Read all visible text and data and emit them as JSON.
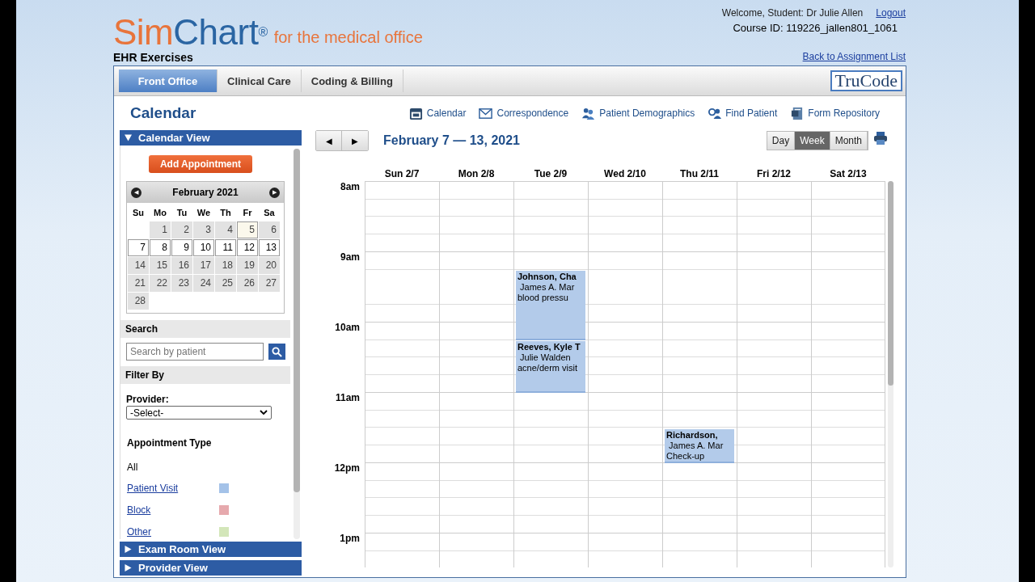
{
  "header": {
    "logo": {
      "part1": "Sim",
      "part2": "Chart",
      "mark": "®",
      "tagline": "for the medical office"
    },
    "subtitle": "EHR Exercises",
    "welcome": "Welcome, Student: Dr Julie Allen",
    "logout": "Logout",
    "course_id": "Course ID: 119226_jallen801_1061",
    "back_link": "Back to Assignment List"
  },
  "tabs": [
    {
      "label": "Front Office",
      "selected": true
    },
    {
      "label": "Clinical Care",
      "selected": false
    },
    {
      "label": "Coding & Billing",
      "selected": false
    }
  ],
  "trucode": "TruCode",
  "page_title": "Calendar",
  "nav_links": [
    {
      "kind": "calendar",
      "label": "Calendar"
    },
    {
      "kind": "mail",
      "label": "Correspondence"
    },
    {
      "kind": "people",
      "label": "Patient Demographics"
    },
    {
      "kind": "find",
      "label": "Find Patient"
    },
    {
      "kind": "form",
      "label": "Form Repository"
    }
  ],
  "sidebar": {
    "calendar_view": {
      "title": "Calendar View",
      "expanded": true,
      "add_button": "Add Appointment",
      "month": "February 2021",
      "prev": "◀",
      "next": "▶",
      "weekdays": [
        "Su",
        "Mo",
        "Tu",
        "We",
        "Th",
        "Fr",
        "Sa"
      ],
      "weeks": [
        [
          {
            "label": "1",
            "selected": false,
            "today": false
          },
          {
            "label": "2",
            "selected": false,
            "today": false
          },
          {
            "label": "3",
            "selected": false,
            "today": false
          },
          {
            "label": "4",
            "selected": false,
            "today": false
          },
          {
            "label": "5",
            "selected": false,
            "today": true
          },
          {
            "label": "6",
            "selected": false,
            "today": false
          }
        ],
        [
          {
            "label": "7",
            "selected": true,
            "today": false
          },
          {
            "label": "8",
            "selected": true,
            "today": false
          },
          {
            "label": "9",
            "selected": true,
            "today": false
          },
          {
            "label": "10",
            "selected": true,
            "today": false
          },
          {
            "label": "11",
            "selected": true,
            "today": false
          },
          {
            "label": "12",
            "selected": true,
            "today": false
          },
          {
            "label": "13",
            "selected": true,
            "today": false
          }
        ],
        [
          {
            "label": "14",
            "selected": false,
            "today": false
          },
          {
            "label": "15",
            "selected": false,
            "today": false
          },
          {
            "label": "16",
            "selected": false,
            "today": false
          },
          {
            "label": "17",
            "selected": false,
            "today": false
          },
          {
            "label": "18",
            "selected": false,
            "today": false
          },
          {
            "label": "19",
            "selected": false,
            "today": false
          },
          {
            "label": "20",
            "selected": false,
            "today": false
          }
        ],
        [
          {
            "label": "21",
            "selected": false,
            "today": false
          },
          {
            "label": "22",
            "selected": false,
            "today": false
          },
          {
            "label": "23",
            "selected": false,
            "today": false
          },
          {
            "label": "24",
            "selected": false,
            "today": false
          },
          {
            "label": "25",
            "selected": false,
            "today": false
          },
          {
            "label": "26",
            "selected": false,
            "today": false
          },
          {
            "label": "27",
            "selected": false,
            "today": false
          }
        ],
        [
          {
            "label": "28",
            "selected": false,
            "today": false
          }
        ]
      ],
      "search_heading": "Search",
      "search_placeholder": "Search by patient",
      "filter_heading": "Filter By",
      "provider_label": "Provider:",
      "provider_value": "-Select-",
      "type_heading": "Appointment Type",
      "type_all": "All",
      "types": [
        {
          "label": "Patient Visit",
          "color": "#a4c2e8"
        },
        {
          "label": "Block",
          "color": "#e6a9ad"
        },
        {
          "label": "Other",
          "color": "#d3e6b9"
        }
      ]
    },
    "other_views": [
      {
        "title": "Exam Room View",
        "expanded": false
      },
      {
        "title": "Provider View",
        "expanded": false
      }
    ]
  },
  "calendar": {
    "prev": "◀",
    "next": "▶",
    "range": "February 7 — 13, 2021",
    "views": [
      {
        "label": "Day",
        "selected": false
      },
      {
        "label": "Week",
        "selected": true
      },
      {
        "label": "Month",
        "selected": false
      }
    ],
    "hours": [
      "8am",
      "9am",
      "10am",
      "11am",
      "12pm",
      "1pm"
    ],
    "days": [
      {
        "label": "Sun 2/7"
      },
      {
        "label": "Mon 2/8"
      },
      {
        "label": "Tue 2/9",
        "appointments": [
          {
            "patient": "Johnson, Cha",
            "provider": "James A. Mar",
            "reason": "blood pressu"
          },
          {
            "patient": "Reeves, Kyle T",
            "provider": "Julie Walden",
            "reason": "acne/derm visit"
          }
        ]
      },
      {
        "label": "Wed 2/10"
      },
      {
        "label": "Thu 2/11",
        "appointments": [
          {
            "patient": "Richardson,",
            "provider": "James A. Mar",
            "reason": "Check-up"
          }
        ]
      },
      {
        "label": "Fri 2/12"
      },
      {
        "label": "Sat 2/13"
      }
    ]
  }
}
